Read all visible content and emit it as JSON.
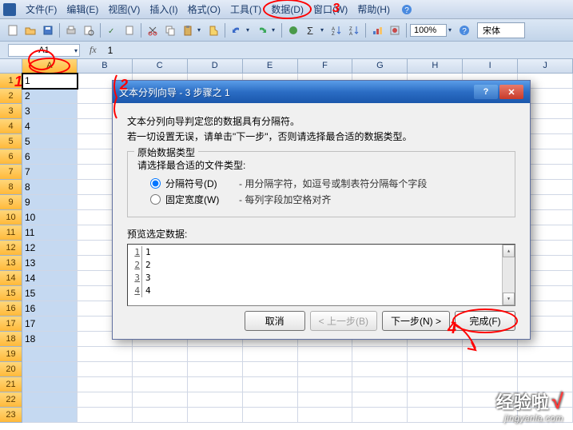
{
  "menubar": {
    "items": [
      {
        "label": "文件(F)"
      },
      {
        "label": "编辑(E)"
      },
      {
        "label": "视图(V)"
      },
      {
        "label": "插入(I)"
      },
      {
        "label": "格式(O)"
      },
      {
        "label": "工具(T)"
      },
      {
        "label": "数据(D)",
        "circled": true
      },
      {
        "label": "窗口(W)"
      },
      {
        "label": "帮助(H)"
      }
    ]
  },
  "toolbar": {
    "zoom": "100%",
    "font": "宋体"
  },
  "namebox": "A1",
  "fx": "fx",
  "formula_value": "1",
  "columns": [
    "A",
    "B",
    "C",
    "D",
    "E",
    "F",
    "G",
    "H",
    "I",
    "J"
  ],
  "rows_visible": 23,
  "col_a_values": [
    "1",
    "2",
    "3",
    "4",
    "5",
    "6",
    "7",
    "8",
    "9",
    "10",
    "11",
    "12",
    "13",
    "14",
    "15",
    "16",
    "17",
    "18",
    "",
    "",
    "",
    "",
    ""
  ],
  "dialog": {
    "title": "文本分列向导 - 3 步骤之 1",
    "intro_line1": "文本分列向导判定您的数据具有分隔符。",
    "intro_line2": "若一切设置无误，请单击\"下一步\"，否则请选择最合适的数据类型。",
    "group_title": "原始数据类型",
    "group_sub": "请选择最合适的文件类型:",
    "radio1_label": "分隔符号(D)",
    "radio1_desc": "- 用分隔字符，如逗号或制表符分隔每个字段",
    "radio2_label": "固定宽度(W)",
    "radio2_desc": "- 每列字段加空格对齐",
    "preview_label": "预览选定数据:",
    "preview_rows": [
      {
        "n": "1",
        "v": "1"
      },
      {
        "n": "2",
        "v": "2"
      },
      {
        "n": "3",
        "v": "3"
      },
      {
        "n": "4",
        "v": "4"
      }
    ],
    "btn_cancel": "取消",
    "btn_back": "< 上一步(B)",
    "btn_next": "下一步(N) >",
    "btn_finish": "完成(F)"
  },
  "annotations": {
    "num1_near_namebox": "1",
    "num2_near_cols": "2",
    "num3_near_menu": "3",
    "num4_near_finish": "4"
  },
  "watermark": {
    "main": "经验啦",
    "check": "√",
    "sub": "jingyanla.com"
  }
}
